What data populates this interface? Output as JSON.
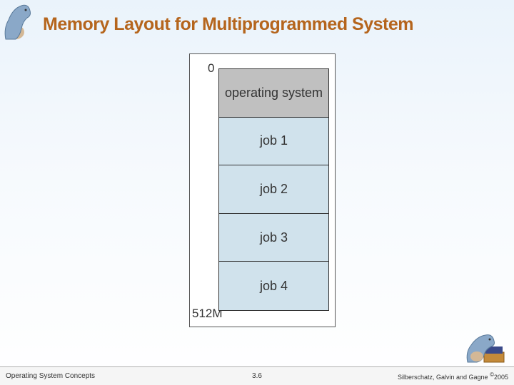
{
  "slide": {
    "title": "Memory Layout for Multiprogrammed System"
  },
  "chart_data": {
    "type": "table",
    "title": "Memory Layout",
    "address_top": "0",
    "address_bottom": "512M",
    "segments": [
      {
        "label": "operating system",
        "shade": "os"
      },
      {
        "label": "job 1",
        "shade": "job"
      },
      {
        "label": "job 2",
        "shade": "job"
      },
      {
        "label": "job 3",
        "shade": "job"
      },
      {
        "label": "job 4",
        "shade": "job"
      }
    ]
  },
  "footer": {
    "left": "Operating System Concepts",
    "center": "3.6",
    "right_prefix": "Silberschatz, Galvin and Gagne ",
    "right_copy": "©",
    "right_year": "2005"
  }
}
